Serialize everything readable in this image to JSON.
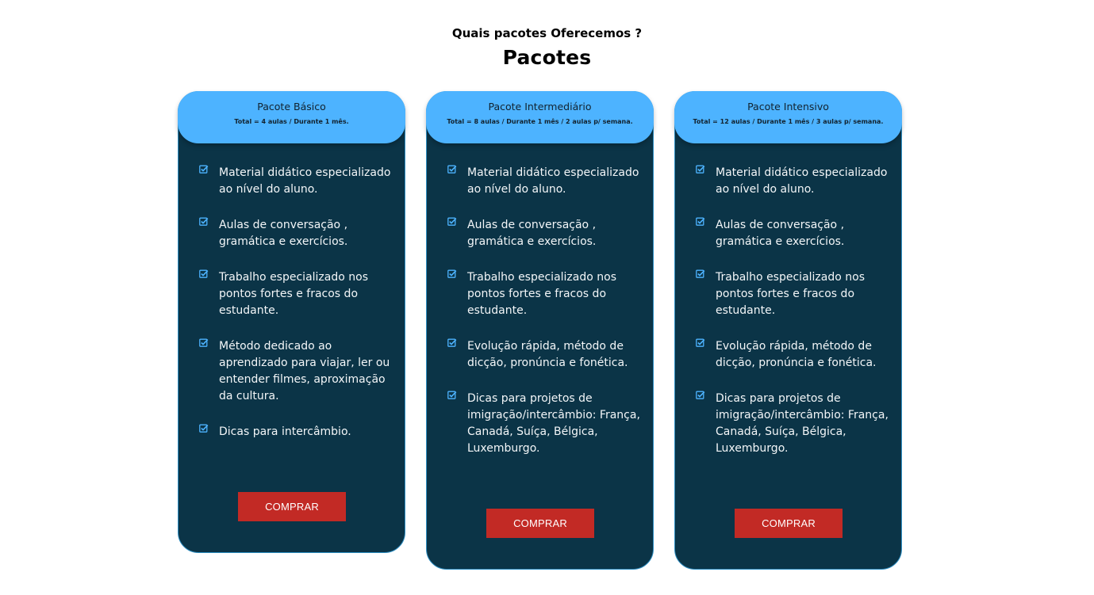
{
  "section": {
    "subtitle": "Quais pacotes Oferecemos ?",
    "title": "Pacotes"
  },
  "colors": {
    "card_bg": "#0b3447",
    "card_header": "#4db3ff",
    "check_icon": "#4db3ff",
    "buy_button": "#c22a25"
  },
  "packages": [
    {
      "name": "Pacote Básico",
      "meta": "Total = 4 aulas / Durante 1 mês.",
      "features": [
        "Material didático especializado ao nível do aluno.",
        "Aulas de conversação , gramática e exercícios.",
        "Trabalho especializado nos pontos fortes e fracos do estudante.",
        "Método dedicado ao aprendizado para viajar, ler ou entender filmes, aproximação da cultura.",
        "Dicas para intercâmbio."
      ],
      "button": "COMPRAR"
    },
    {
      "name": "Pacote Intermediário",
      "meta": "Total = 8 aulas / Durante 1 mês / 2 aulas p/ semana.",
      "features": [
        "Material didático especializado ao nível do aluno.",
        "Aulas de conversação , gramática e exercícios.",
        "Trabalho especializado nos pontos fortes e fracos do estudante.",
        "Evolução rápida, método de dicção, pronúncia e fonética.",
        "Dicas para projetos de imigração/intercâmbio: França, Canadá, Suíça, Bélgica, Luxemburgo."
      ],
      "button": "COMPRAR"
    },
    {
      "name": "Pacote Intensivo",
      "meta": "Total = 12 aulas / Durante 1 mês / 3 aulas p/ semana.",
      "features": [
        "Material didático especializado ao nível do aluno.",
        "Aulas de conversação , gramática e exercícios.",
        "Trabalho especializado nos pontos fortes e fracos do estudante.",
        "Evolução rápida, método de dicção, pronúncia e fonética.",
        "Dicas para projetos de imigração/intercâmbio: França, Canadá, Suíça, Bélgica, Luxemburgo."
      ],
      "button": "COMPRAR"
    }
  ]
}
